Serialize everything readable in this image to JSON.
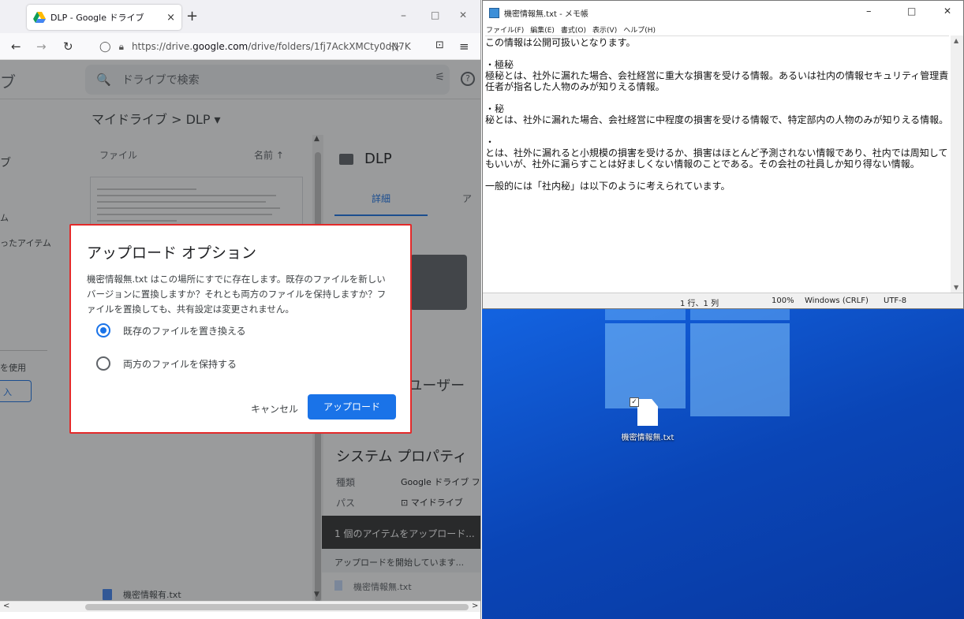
{
  "browser": {
    "tab_title": "DLP - Google ドライブ",
    "tab_close": "×",
    "new_tab": "+",
    "controls": {
      "minimize": "–",
      "maximize": "□",
      "close": "✕"
    },
    "nav": {
      "back": "←",
      "forward": "→",
      "reload": "↻"
    },
    "url_prefix": "https://drive.",
    "url_host": "google.com",
    "url_path": "/drive/folders/1fj7AckXMCty0dN7K",
    "star": "☆",
    "pocket": "⊡",
    "menu": "≡"
  },
  "drive": {
    "logo_text": "ブ",
    "search_placeholder": "ドライブで検索",
    "search_icon": "🔍",
    "tune_icon": "⚟",
    "help_icon": "?",
    "breadcrumb": "マイドライブ  >  DLP  ▾",
    "sidebar": {
      "item1": "ブ",
      "item2": "ム",
      "item3": "ったアイテム",
      "item4": "を使用",
      "storage_btn": "入"
    },
    "list_header": "ファイル",
    "sort_label": "名前  ↑",
    "file_row": "機密情報有.txt",
    "details": {
      "folder_name": "DLP",
      "tab_details": "詳細",
      "tab_activity": "ア",
      "access_text": "Sユーザー",
      "system_props": "システム プロパティ",
      "type_label": "種類",
      "type_value": "Google ドライブ フォ",
      "location_label": "パス",
      "location_value": "マイドライブ"
    },
    "upload_panel": {
      "header": "1 個のアイテムをアップロード...",
      "status": "アップロードを開始しています...",
      "file": "機密情報無.txt"
    }
  },
  "dialog": {
    "title": "アップロード オプション",
    "body": "機密情報無.txt はこの場所にすでに存在します。既存のファイルを新しいバージョンに置換しますか？それとも両方のファイルを保持しますか？ファイルを置換しても、共有設定は変更されません。",
    "option_replace": "既存のファイルを置き換える",
    "option_keep_both": "両方のファイルを保持する",
    "selected": "option_replace",
    "cancel": "キャンセル",
    "upload": "アップロード"
  },
  "notepad": {
    "title": "機密情報無.txt - メモ帳",
    "controls": {
      "minimize": "–",
      "maximize": "□",
      "close": "✕"
    },
    "menu": [
      "ファイル(F)",
      "編集(E)",
      "書式(O)",
      "表示(V)",
      "ヘルプ(H)"
    ],
    "content": "この情報は公開可扱いとなります。\n\n・極秘\n極秘とは、社外に漏れた場合、会社経営に重大な損害を受ける情報。あるいは社内の情報セキュリティ管理責任者が指名した人物のみが知りえる情報。\n\n・秘\n秘とは、社外に漏れた場合、会社経営に中程度の損害を受ける情報で、特定部内の人物のみが知りえる情報。\n\n・\nとは、社外に漏れると小規模の損害を受けるか、損害はほとんど予測されない情報であり、社内では周知してもいいが、社外に漏らすことは好ましくない情報のことである。その会社の社員しか知り得ない情報。\n\n一般的には「社内秘」は以下のように考えられています。",
    "status": {
      "position": "1 行、1 列",
      "zoom": "100%",
      "line_ending": "Windows (CRLF)",
      "encoding": "UTF-8"
    }
  },
  "desktop": {
    "icon_label": "機密情報無.txt"
  },
  "colors": {
    "accent": "#1a73e8",
    "dialog_border": "#e32a2a",
    "desktop_bg": "#1362df"
  }
}
